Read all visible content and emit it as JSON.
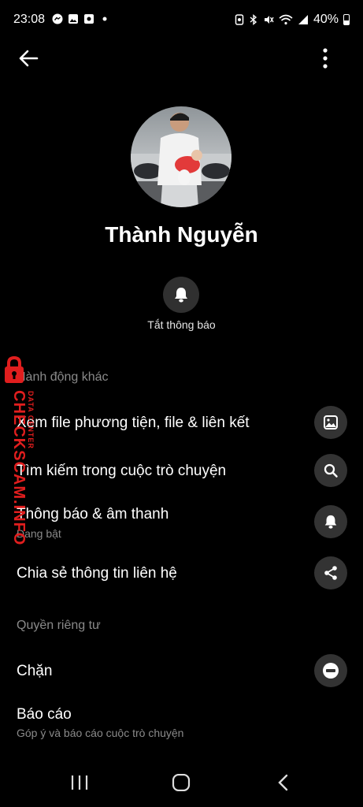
{
  "status_bar": {
    "time": "23:08",
    "battery": "40%",
    "left_icons": [
      "messenger-icon",
      "gallery-icon",
      "app-icon",
      "dot-icon"
    ],
    "right_icons": [
      "alarm-icon",
      "bluetooth-icon",
      "mute-icon",
      "wifi-icon",
      "signal-icon",
      "battery-icon"
    ]
  },
  "profile": {
    "name": "Thành Nguyễn"
  },
  "mute": {
    "label": "Tắt thông báo"
  },
  "sections": {
    "actions_header": "Hành động khác",
    "privacy_header": "Quyền riêng tư"
  },
  "rows": {
    "media": {
      "title": "Xem file phương tiện, file & liên kết",
      "icon": "image-icon"
    },
    "search": {
      "title": "Tìm kiếm trong cuộc trò chuyện",
      "icon": "search-icon"
    },
    "notifications": {
      "title": "Thông báo & âm thanh",
      "subtitle": "Đang bật",
      "icon": "bell-icon"
    },
    "share": {
      "title": "Chia sẻ thông tin liên hệ",
      "icon": "share-icon"
    },
    "block": {
      "title": "Chặn",
      "icon": "block-icon"
    },
    "report": {
      "title": "Báo cáo",
      "subtitle": "Góp ý và báo cáo cuộc trò chuyện"
    }
  },
  "watermark": {
    "text": "CHECKSCAM.INFO",
    "sub": "DATA CENTER"
  },
  "colors": {
    "background": "#000000",
    "button_bg": "#333333",
    "secondary_text": "#8a8a8a",
    "watermark": "#e01e1e"
  }
}
